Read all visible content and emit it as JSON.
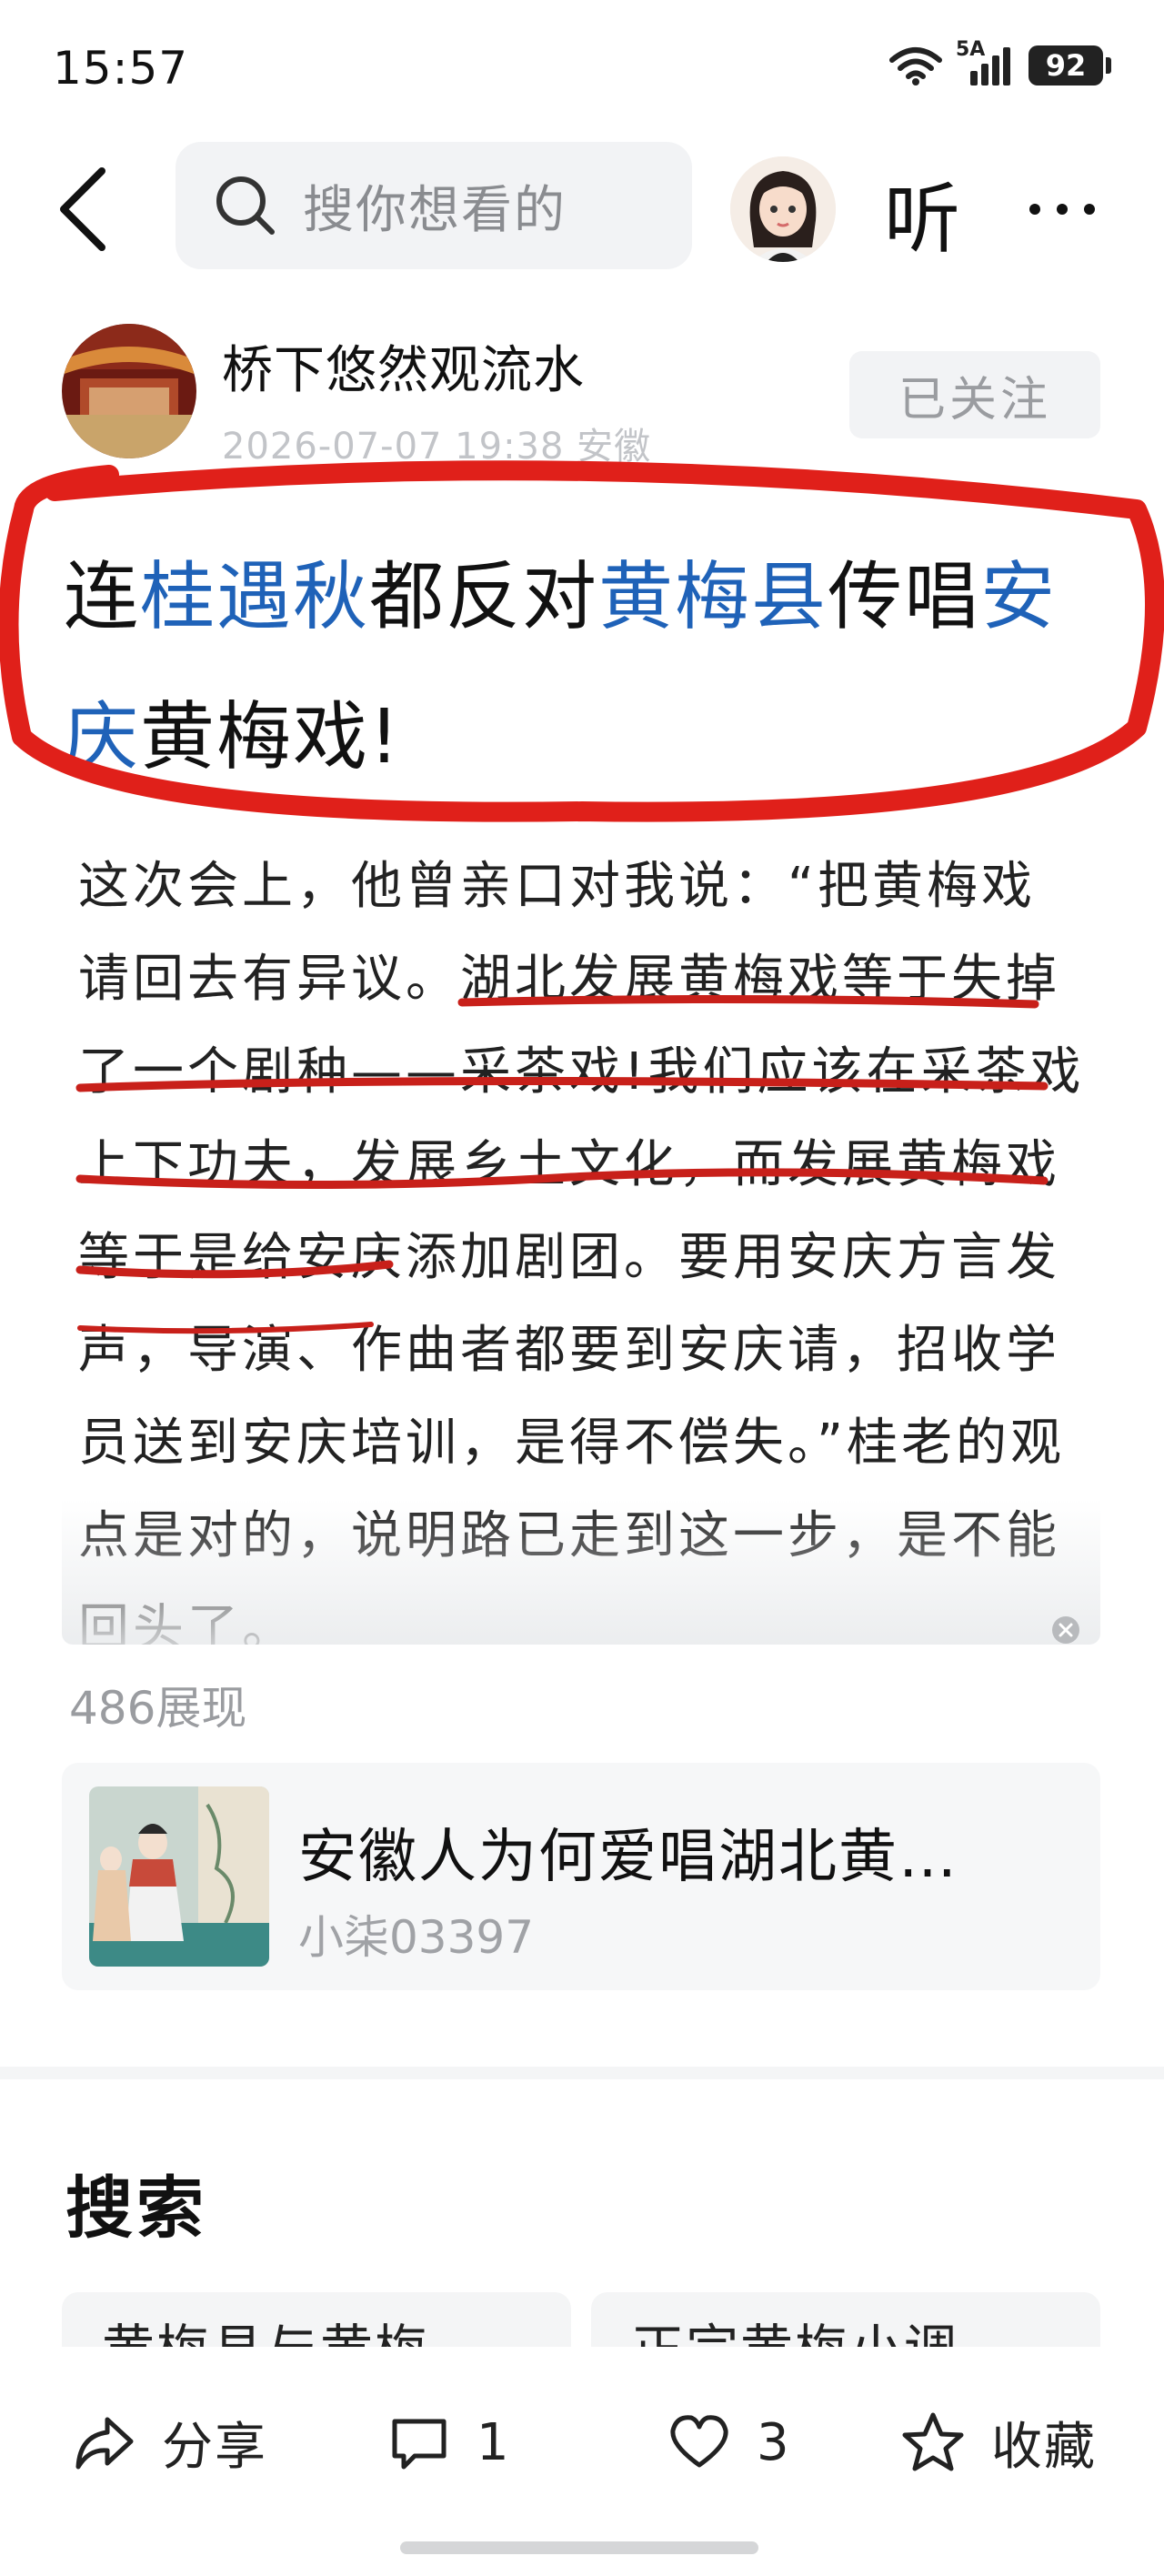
{
  "status_bar": {
    "time": "15:57",
    "network": "5A",
    "battery": "92"
  },
  "nav": {
    "search_placeholder": "搜你想看的",
    "listen_label": "听"
  },
  "author": {
    "name": "桥下悠然观流水",
    "meta": "2026-07-07 19:38 安徽",
    "follow_label": "已关注"
  },
  "headline": {
    "parts": [
      "连",
      "桂遇秋",
      "都反对",
      "黄梅县",
      "传唱",
      "安庆",
      "黄梅戏!"
    ]
  },
  "article": {
    "text": "这次会上，他曾亲口对我说：“把黄梅戏请回去有异议。湖北发展黄梅戏等于失掉了一个剧种——采茶戏!我们应该在采茶戏上下功夫，发展乡土文化，而发展黄梅戏等于是给安庆添加剧团。要用安庆方言发声，导演、作曲者都要到安庆请，招收学员送到安庆培训，是得不偿失。”桂老的观点是对的，说明路已走到这一步，是不能回头了。"
  },
  "views": "486展现",
  "related": {
    "title": "安徽人为何爱唱湖北黄…",
    "author": "小柒03397"
  },
  "search_section": {
    "heading": "搜索",
    "chips": [
      "黄梅县与黄梅",
      "正宗黄梅小调"
    ]
  },
  "actions": {
    "share": "分享",
    "comment_count": "1",
    "like_count": "3",
    "collect": "收藏"
  },
  "colors": {
    "accent_blue": "#1f62b8",
    "circle_red": "#e0201a",
    "underline_red": "#c8201a"
  }
}
